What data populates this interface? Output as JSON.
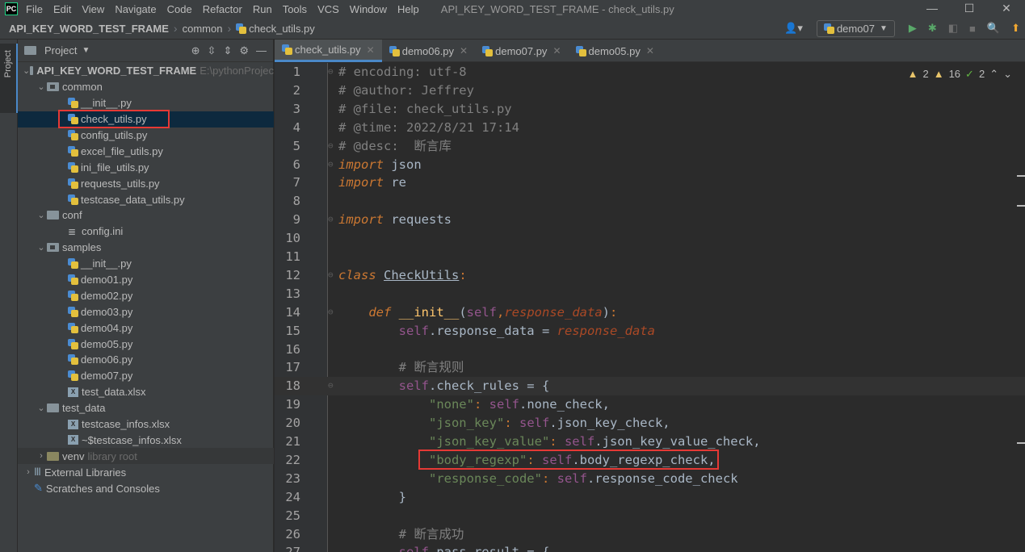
{
  "menubar": {
    "items": [
      "File",
      "Edit",
      "View",
      "Navigate",
      "Code",
      "Refactor",
      "Run",
      "Tools",
      "VCS",
      "Window",
      "Help"
    ],
    "window_title": "API_KEY_WORD_TEST_FRAME - check_utils.py"
  },
  "navbar": {
    "project": "API_KEY_WORD_TEST_FRAME",
    "folder": "common",
    "file": "check_utils.py",
    "run_config": "demo07"
  },
  "panel": {
    "title": "Project",
    "root_label": "API_KEY_WORD_TEST_FRAME",
    "root_path": "E:\\pythonProjec",
    "common": "common",
    "common_files": [
      "__init__.py",
      "check_utils.py",
      "config_utils.py",
      "excel_file_utils.py",
      "ini_file_utils.py",
      "requests_utils.py",
      "testcase_data_utils.py"
    ],
    "conf": "conf",
    "conf_files": [
      "config.ini"
    ],
    "samples": "samples",
    "samples_files": [
      "__init__.py",
      "demo01.py",
      "demo02.py",
      "demo03.py",
      "demo04.py",
      "demo05.py",
      "demo06.py",
      "demo07.py"
    ],
    "samples_xlsx": "test_data.xlsx",
    "test_data": "test_data",
    "test_data_files": [
      "testcase_infos.xlsx",
      "~$testcase_infos.xlsx"
    ],
    "venv": "venv",
    "venv_note": "library root",
    "external": "External Libraries",
    "scratches": "Scratches and Consoles"
  },
  "tabs": [
    "check_utils.py",
    "demo06.py",
    "demo07.py",
    "demo05.py"
  ],
  "inspections": {
    "warnings_a": "2",
    "warnings_b": "16",
    "weak": "2"
  },
  "editor": {
    "line_numbers": [
      "1",
      "2",
      "3",
      "4",
      "5",
      "6",
      "7",
      "8",
      "9",
      "10",
      "11",
      "12",
      "13",
      "14",
      "15",
      "16",
      "17",
      "18",
      "19",
      "20",
      "21",
      "22",
      "23",
      "24",
      "25",
      "26",
      "27"
    ],
    "l1": "# encoding: utf-8",
    "l2": "# @author: Jeffrey",
    "l3": "# @file: check_utils.py",
    "l4": "# @time: 2022/8/21 17:14",
    "l5": "# @desc:  断言库",
    "l6_kw": "import",
    "l6_mod": " json",
    "l7_kw": "import",
    "l7_mod": " re",
    "l9_kw": "import",
    "l9_mod": " requests",
    "l12_kw": "class",
    "l12_name": "CheckUtils",
    "l12_colon": ":",
    "l14_def": "def",
    "l14_init": "__init__",
    "l14_self": "self",
    "l14_param": "response_data",
    "l15_self": "self",
    "l15_attr": ".response_data = ",
    "l15_val": "response_data",
    "l17": "# 断言规则",
    "l18_self": "self",
    "l18_attr": ".check_rules = {",
    "l19_key": "\"none\"",
    "l19_self": "self",
    "l19_val": ".none_check,",
    "l20_key": "\"json_key\"",
    "l20_self": "self",
    "l20_val": ".json_key_check,",
    "l21_key": "\"json_key_value\"",
    "l21_self": "self",
    "l21_val": ".json_key_value_check,",
    "l22_key": "\"body_regexp\"",
    "l22_self": "self",
    "l22_val": ".body_regexp_check,",
    "l23_key": "\"response_code\"",
    "l23_self": "self",
    "l23_val": ".response_code_check",
    "l24": "}",
    "l26": "# 断言成功",
    "l27_self": "self",
    "l27_attr": ".pass_result = {"
  }
}
